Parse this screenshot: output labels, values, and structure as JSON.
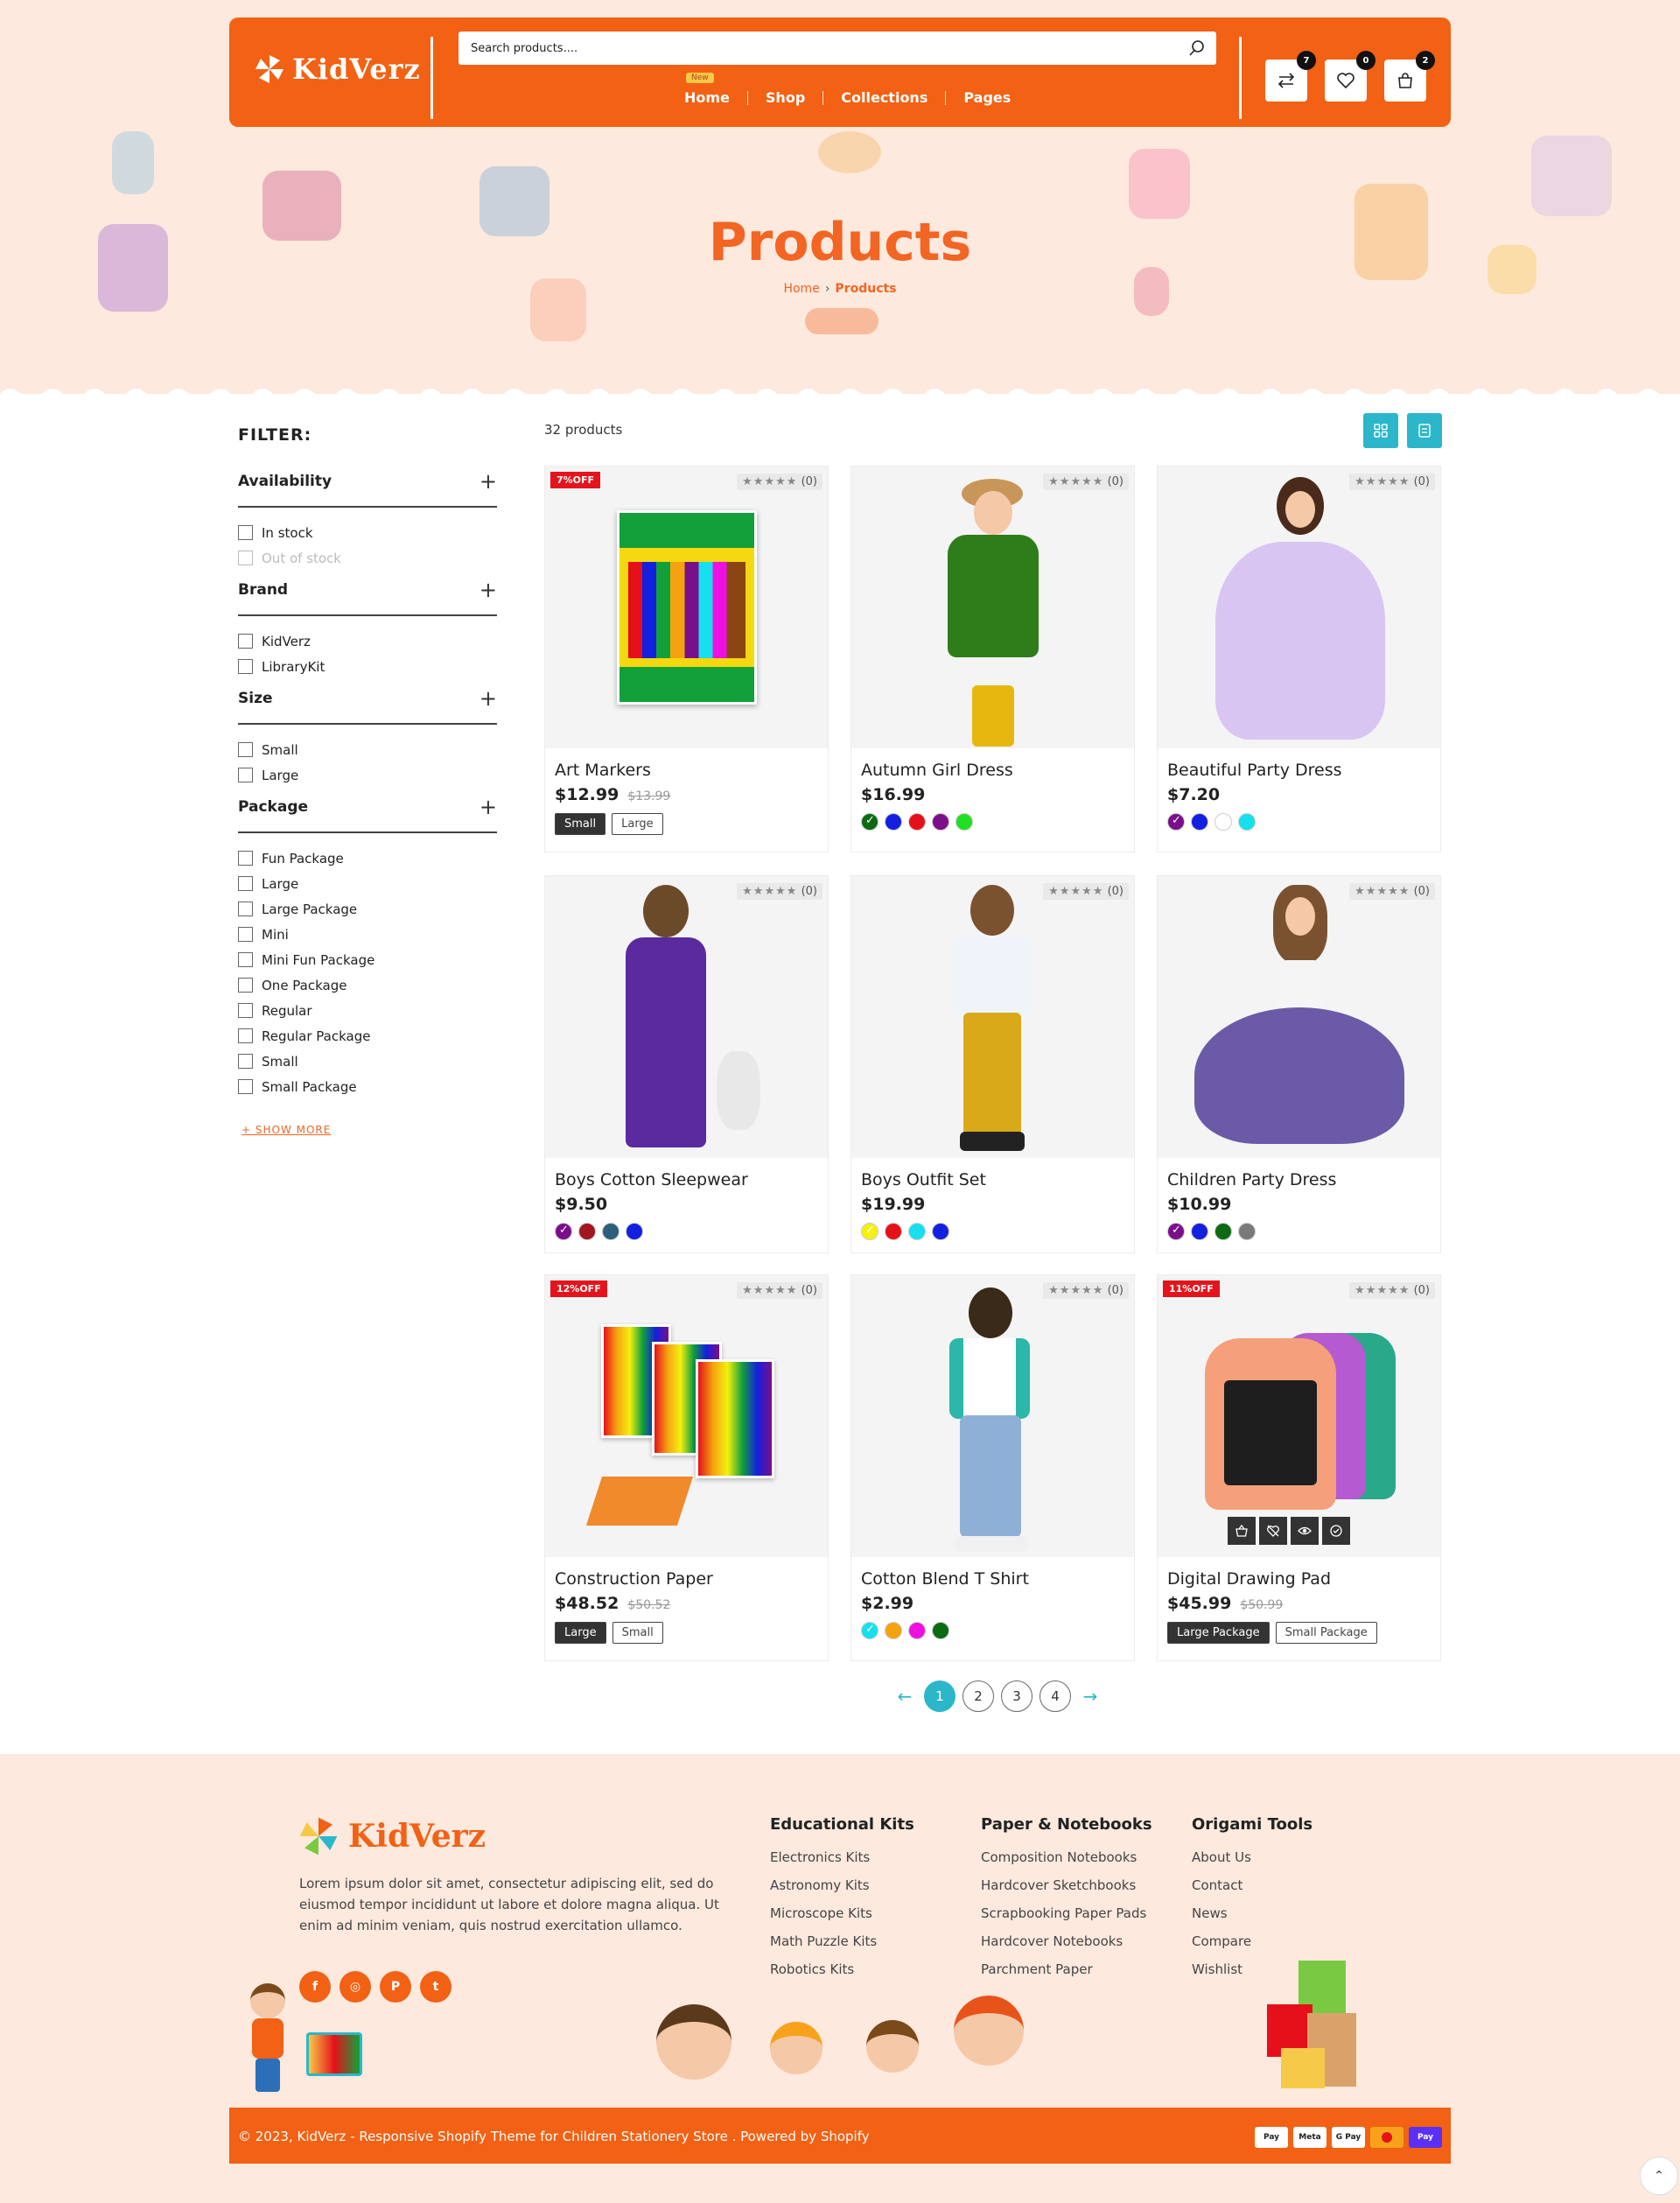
{
  "header": {
    "logo_text": "KidVerz",
    "search_placeholder": "Search products....",
    "nav": [
      {
        "label": "Home",
        "badge": "New"
      },
      {
        "label": "Shop"
      },
      {
        "label": "Collections"
      },
      {
        "label": "Pages"
      }
    ],
    "compare_count": "7",
    "wishlist_count": "0",
    "cart_count": "2",
    "brand_color": "#f26114"
  },
  "hero": {
    "title": "Products",
    "breadcrumb_home": "Home",
    "breadcrumb_current": "Products"
  },
  "sidebar": {
    "title": "FILTER:",
    "groups": [
      {
        "title": "Availability",
        "options": [
          "In stock",
          "Out of stock"
        ]
      },
      {
        "title": "Brand",
        "options": [
          "KidVerz",
          "LibraryKit"
        ]
      },
      {
        "title": "Size",
        "options": [
          "Small",
          "Large"
        ]
      },
      {
        "title": "Package",
        "options": [
          "Fun Package",
          "Large",
          "Large Package",
          "Mini",
          "Mini Fun Package",
          "One Package",
          "Regular",
          "Regular Package",
          "Small",
          "Small Package"
        ]
      }
    ],
    "show_more": "+ SHOW MORE"
  },
  "toolbar": {
    "count": "32 products",
    "accent": "#2bb7c9"
  },
  "products": [
    {
      "name": "Art Markers",
      "price": "$12.99",
      "old": "$13.99",
      "badge": "7%OFF",
      "rating": "(0)",
      "sizes": [
        "Small",
        "Large"
      ],
      "active_size": 0
    },
    {
      "name": "Autumn Girl Dress",
      "price": "$16.99",
      "rating": "(0)",
      "swatches": [
        "#0c6b12",
        "#1320e0",
        "#e6101a",
        "#7d0f8a",
        "#21e021"
      ]
    },
    {
      "name": "Beautiful Party Dress",
      "price": "$7.20",
      "rating": "(0)",
      "swatches": [
        "#7a0f8a",
        "#1320e0",
        "#ffffff",
        "#16e0f0"
      ]
    },
    {
      "name": "Boys Cotton Sleepwear",
      "price": "$9.50",
      "rating": "(0)",
      "swatches": [
        "#7a0f8a",
        "#a3151f",
        "#2d5f7c",
        "#1320e0"
      ]
    },
    {
      "name": "Boys Outfit Set",
      "price": "$19.99",
      "rating": "(0)",
      "swatches": [
        "#f5f00f",
        "#e6101a",
        "#16e0f0",
        "#1320e0"
      ]
    },
    {
      "name": "Children Party Dress",
      "price": "$10.99",
      "rating": "(0)",
      "swatches": [
        "#7a0f8a",
        "#1320e0",
        "#0c6b12",
        "#7a7a7a"
      ]
    },
    {
      "name": "Construction Paper",
      "price": "$48.52",
      "old": "$50.52",
      "badge": "12%OFF",
      "rating": "(0)",
      "sizes": [
        "Large",
        "Small"
      ],
      "active_size": 0
    },
    {
      "name": "Cotton Blend T Shirt",
      "price": "$2.99",
      "rating": "(0)",
      "swatches": [
        "#16e0f0",
        "#f5a20f",
        "#ee10e0",
        "#0c6b12"
      ]
    },
    {
      "name": "Digital Drawing Pad",
      "price": "$45.99",
      "old": "$50.99",
      "badge": "11%OFF",
      "rating": "(0)",
      "sizes": [
        "Large Package",
        "Small Package"
      ],
      "active_size": 0
    }
  ],
  "pagination": {
    "pages": [
      "1",
      "2",
      "3",
      "4"
    ],
    "current": "1"
  },
  "footer": {
    "logo_text": "KidVerz",
    "description": "Lorem ipsum dolor sit amet, consectetur adipiscing elit, sed do eiusmod tempor incididunt ut labore et dolore magna aliqua. Ut enim ad minim veniam, quis nostrud exercitation ullamco.",
    "columns": [
      {
        "title": "Educational Kits",
        "links": [
          "Electronics Kits",
          "Astronomy Kits",
          "Microscope Kits",
          "Math Puzzle Kits",
          "Robotics Kits"
        ]
      },
      {
        "title": "Paper & Notebooks",
        "links": [
          "Composition Notebooks",
          "Hardcover Sketchbooks",
          "Scrapbooking Paper Pads",
          "Hardcover Notebooks",
          "Parchment Paper"
        ]
      },
      {
        "title": "Origami Tools",
        "links": [
          "About Us",
          "Contact",
          "News",
          "Compare",
          "Wishlist"
        ]
      }
    ],
    "copyright": "© 2023, KidVerz - Responsive Shopify Theme for Children Stationery Store . Powered by Shopify",
    "payments": [
      "Pay",
      "Meta",
      "G Pay",
      "MC",
      "Pay"
    ]
  }
}
